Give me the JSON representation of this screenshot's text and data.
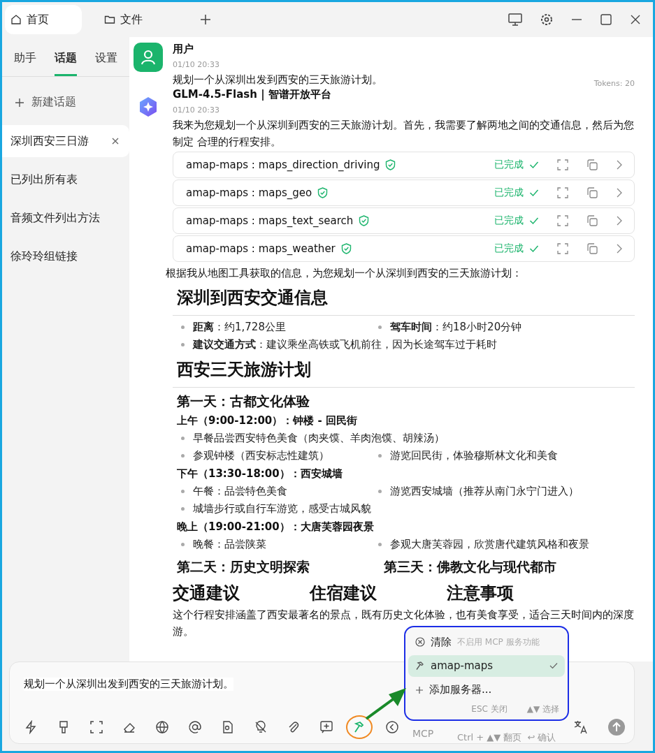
{
  "tabs": [
    {
      "label": "首页",
      "kind": "home",
      "selected": true
    },
    {
      "label": "文件",
      "kind": "folder",
      "selected": false
    }
  ],
  "sidebar": {
    "tabs": [
      {
        "label": "助手",
        "selected": false
      },
      {
        "label": "话题",
        "selected": true
      },
      {
        "label": "设置",
        "selected": false
      }
    ],
    "new_topic": "新建话题",
    "topics": [
      {
        "title": "深圳西安三日游",
        "selected": true
      },
      {
        "title": "已列出所有表",
        "selected": false
      },
      {
        "title": "音频文件列出方法",
        "selected": false
      },
      {
        "title": "徐玲玲组链接",
        "selected": false
      }
    ]
  },
  "user_message": {
    "name": "用户",
    "time": "01/10 20:33",
    "text": "规划一个从深圳出发到西安的三天旅游计划。",
    "tokens": "Tokens: 20"
  },
  "assistant_message": {
    "name": "GLM-4.5-Flash | 智谱开放平台",
    "time": "01/10 20:33",
    "intro": "我来为您规划一个从深圳到西安的三天旅游计划。首先，我需要了解两地之间的交通信息，然后为您制定 合理的行程安排。",
    "tool_calls": [
      {
        "name": "amap-maps : maps_direction_driving",
        "status": "已完成",
        "done": true
      },
      {
        "name": "amap-maps : maps_geo",
        "status": "已完成",
        "done": true
      },
      {
        "name": "amap-maps : maps_text_search",
        "status": "已完成",
        "done": true
      },
      {
        "name": "amap-maps : maps_weather",
        "status": "已完成",
        "done": true
      }
    ],
    "blocks": [
      {
        "kind": "p",
        "texts": [
          "根据我从地图工具获取的信息，为您规划一个从深圳到西安的三天旅游计划："
        ]
      },
      {
        "kind": "h2",
        "texts": [
          "深圳到西安交通信息"
        ]
      },
      {
        "kind": "list",
        "rows": [
          [
            "**距离**：约1,728公里",
            "**驾车时间**：约18小时20分钟"
          ],
          [
            "**建议交通方式**：建议乘坐高铁或飞机前往，因为长途驾车过于耗时"
          ]
        ]
      },
      {
        "kind": "h2",
        "texts": [
          "西安三天旅游计划"
        ]
      },
      {
        "kind": "h3",
        "texts": [
          "第一天：古都文化体验"
        ]
      },
      {
        "kind": "h4",
        "texts": [
          "上午（9:00-12:00）：钟楼 - 回民街"
        ]
      },
      {
        "kind": "list",
        "rows": [
          [
            "早餐品尝西安特色美食（肉夹馍、羊肉泡馍、胡辣汤）"
          ],
          [
            "参观钟楼（西安标志性建筑）",
            "游览回民街，体验穆斯林文化和美食"
          ]
        ]
      },
      {
        "kind": "h4",
        "texts": [
          "下午（13:30-18:00）：西安城墙"
        ]
      },
      {
        "kind": "list",
        "rows": [
          [
            "午餐：品尝特色美食",
            "游览西安城墙（推荐从南门永宁门进入）"
          ],
          [
            "城墙步行或自行车游览，感受古城风貌"
          ]
        ]
      },
      {
        "kind": "h4",
        "texts": [
          "晚上（19:00-21:00）：大唐芙蓉园夜景"
        ]
      },
      {
        "kind": "list",
        "rows": [
          [
            "晚餐：品尝陕菜",
            "参观大唐芙蓉园，欣赏唐代建筑风格和夜景"
          ]
        ]
      },
      {
        "kind": "h3row",
        "texts": [
          "第二天：历史文明探索",
          "第三天：佛教文化与现代都市"
        ]
      },
      {
        "kind": "h2row",
        "texts": [
          "交通建议",
          "住宿建议",
          "注意事项"
        ]
      },
      {
        "kind": "p",
        "texts": [
          "这个行程安排涵盖了西安最著名的景点，既有历史文化体验，也有美食享受，适合三天时间内的深度游。"
        ]
      }
    ]
  },
  "input": {
    "value": "规划一个从深圳出发到西安的三天旅游计划。",
    "mcp_label": "MCP"
  },
  "mcp_menu": {
    "items": [
      {
        "kind": "clear",
        "label": "清除",
        "hint": "不启用 MCP 服务功能",
        "selected": false
      },
      {
        "kind": "server",
        "label": "amap-maps",
        "selected": true
      },
      {
        "kind": "add",
        "label": "添加服务器...",
        "selected": false
      }
    ],
    "hints": [
      "ESC 关闭",
      "▲▼ 选择"
    ],
    "hints_below": [
      "Ctrl + ▲▼ 翻页",
      "↩ 确认"
    ]
  }
}
